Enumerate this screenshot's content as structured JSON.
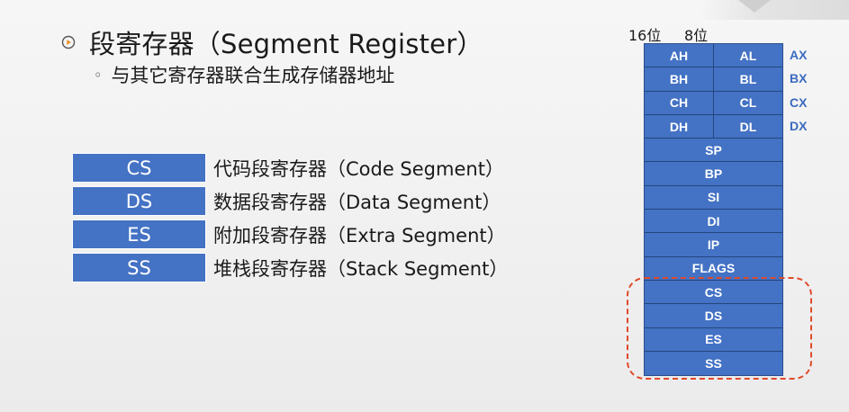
{
  "title": "段寄存器（Segment Register）",
  "subtitle": "与其它寄存器联合生成存储器地址",
  "segments": [
    {
      "name": "CS",
      "desc": "代码段寄存器（Code Segment）"
    },
    {
      "name": "DS",
      "desc": "数据段寄存器（Data Segment）"
    },
    {
      "name": "ES",
      "desc": "附加段寄存器（Extra Segment）"
    },
    {
      "name": "SS",
      "desc": "堆栈段寄存器（Stack Segment）"
    }
  ],
  "register_stack": {
    "col_labels": [
      "16位",
      "8位"
    ],
    "split_rows": [
      {
        "high": "AH",
        "low": "AL",
        "full": "AX"
      },
      {
        "high": "BH",
        "low": "BL",
        "full": "BX"
      },
      {
        "high": "CH",
        "low": "CL",
        "full": "CX"
      },
      {
        "high": "DH",
        "low": "DL",
        "full": "DX"
      }
    ],
    "full_rows": [
      "SP",
      "BP",
      "SI",
      "DI",
      "IP",
      "FLAGS",
      "CS",
      "DS",
      "ES",
      "SS"
    ],
    "highlight_color": "#e04a2a",
    "cell_color": "#4472c4"
  }
}
